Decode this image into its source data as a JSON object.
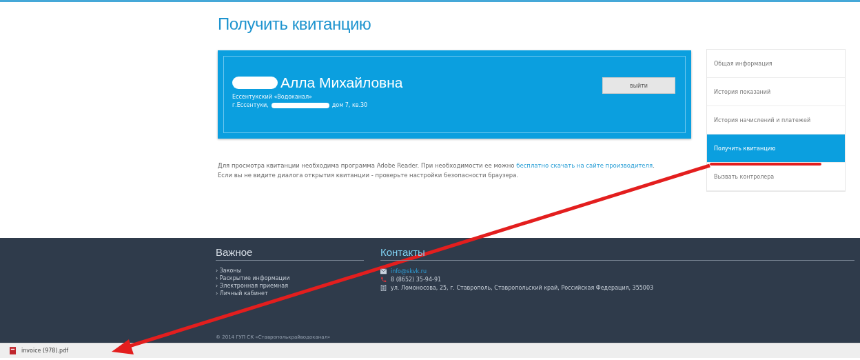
{
  "page": {
    "title": "Получить квитанцию"
  },
  "account": {
    "name": "Алла Михайловна",
    "organization": "Ессентукский «Водоканал»",
    "address_prefix": "г.Ессентуки,",
    "address_suffix": "дом 7, кв.30",
    "logout_button": "выйти"
  },
  "sidebar": {
    "items": [
      {
        "label": "Общая информация",
        "selected": false
      },
      {
        "label": "История показаний",
        "selected": false
      },
      {
        "label": "История начислений и платежей",
        "selected": false
      },
      {
        "label": "Получить квитанцию",
        "selected": true
      },
      {
        "label": "Вызвать контролера",
        "selected": false
      }
    ]
  },
  "info": {
    "text": "Для просмотра квитанции необходима программа Adobe Reader. При необходимости ее можно ",
    "link": "бесплатно скачать на сайте производителя",
    "end": ".",
    "note": "Если вы не видите диалога открытия квитанции - проверьте настройки безопасности браузера."
  },
  "footer": {
    "important": {
      "title": "Важное",
      "links": [
        "› Законы",
        "› Раскрытие информации",
        "› Электронная приемная",
        "› Личный кабинет"
      ]
    },
    "contacts": {
      "title": "Контакты",
      "email": "info@skvk.ru",
      "phone": "8 (8652) 35-94-91",
      "address": "ул. Ломоносова, 25, г. Ставрополь, Ставропольский край, Российская Федерация, 355003"
    },
    "copyright": "© 2014 ГУП СК «Ставрополькрайводоканал»"
  },
  "download_bar": {
    "file": "invoice (978).pdf"
  }
}
